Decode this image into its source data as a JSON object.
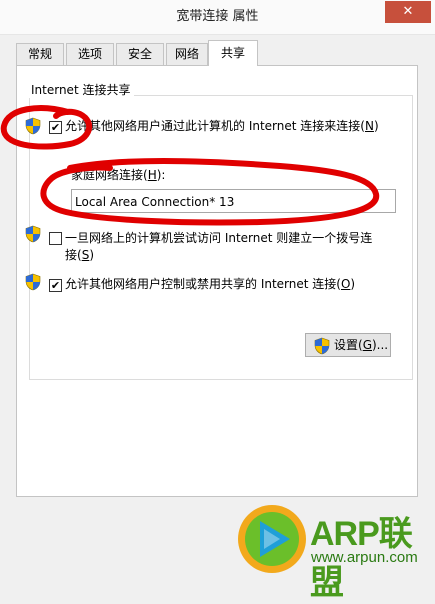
{
  "window": {
    "title": "宽带连接 属性",
    "close_glyph": "✕"
  },
  "tabs": [
    {
      "label": "常规"
    },
    {
      "label": "选项"
    },
    {
      "label": "安全"
    },
    {
      "label": "网络"
    },
    {
      "label": "共享",
      "active": true
    }
  ],
  "sharing": {
    "group_title": "Internet 连接共享",
    "allow_share": {
      "checked": true,
      "label_before": "允许其他网络用户通过此计算机的 Internet 连接来连接(",
      "access_key": "N",
      "label_after": ")"
    },
    "home_network": {
      "label_before": "家庭网络连接(",
      "access_key": "H",
      "label_after": "):",
      "value": "Local Area Connection* 13"
    },
    "dial_on_demand": {
      "checked": false,
      "line1": "一旦网络上的计算机尝试访问 Internet 则建立一个拨号连",
      "line2_before": "接(",
      "access_key": "S",
      "line2_after": ")"
    },
    "allow_control": {
      "checked": true,
      "label_before": "允许其他网络用户控制或禁用共享的 Internet 连接(",
      "access_key": "O",
      "label_after": ")"
    },
    "settings_button": {
      "label_before": "设置(",
      "access_key": "G",
      "label_after": ")..."
    }
  },
  "watermark": {
    "brand": "ARP联盟",
    "url": "www.arpun.com"
  },
  "colors": {
    "annotation_red": "#e00000",
    "close_red": "#c7503c",
    "brand_green": "#4a9a1e"
  }
}
